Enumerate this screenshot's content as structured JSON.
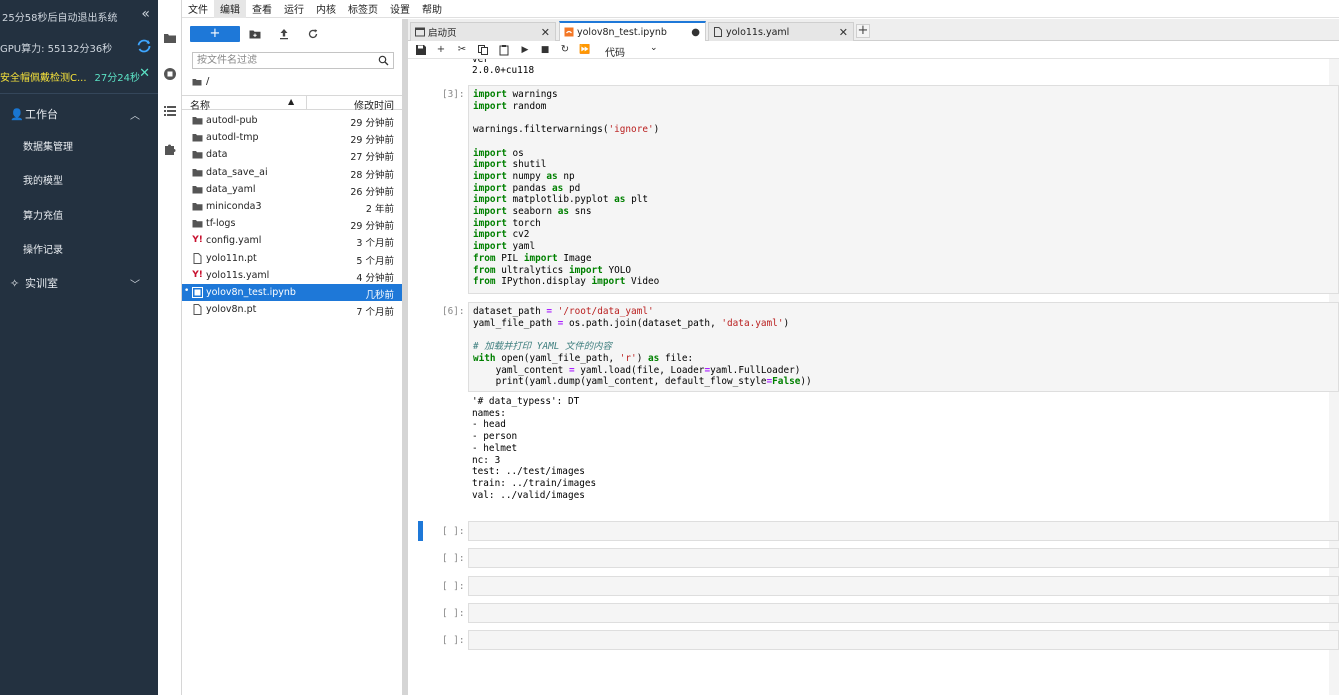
{
  "left_panel": {
    "title": "25分58秒后自动退出系统",
    "gpu": "GPU算力: 55132分36秒",
    "safe_name": "安全帽佩戴检测C...",
    "safe_time": "27分24秒",
    "menu": [
      {
        "label": "工作台"
      },
      {
        "label": "数据集管理"
      },
      {
        "label": "我的模型"
      },
      {
        "label": "算力充值"
      },
      {
        "label": "操作记录"
      },
      {
        "label": "实训室"
      }
    ]
  },
  "menubar": [
    "文件",
    "编辑",
    "查看",
    "运行",
    "内核",
    "标签页",
    "设置",
    "帮助"
  ],
  "filebrowser": {
    "new_label": "+",
    "filter_placeholder": "按文件名过滤",
    "breadcrumb": "/",
    "col_name": "名称",
    "col_modified": "修改时间",
    "files": [
      {
        "name": "autodl-pub",
        "time": "29 分钟前",
        "type": "folder"
      },
      {
        "name": "autodl-tmp",
        "time": "29 分钟前",
        "type": "folder"
      },
      {
        "name": "data",
        "time": "27 分钟前",
        "type": "folder"
      },
      {
        "name": "data_save_ai",
        "time": "28 分钟前",
        "type": "folder"
      },
      {
        "name": "data_yaml",
        "time": "26 分钟前",
        "type": "folder"
      },
      {
        "name": "miniconda3",
        "time": "2 年前",
        "type": "folder"
      },
      {
        "name": "tf-logs",
        "time": "29 分钟前",
        "type": "folder"
      },
      {
        "name": "config.yaml",
        "time": "3 个月前",
        "type": "yaml"
      },
      {
        "name": "yolo11n.pt",
        "time": "5 个月前",
        "type": "file"
      },
      {
        "name": "yolo11s.yaml",
        "time": "4 分钟前",
        "type": "yaml"
      },
      {
        "name": "yolov8n_test.ipynb",
        "time": "几秒前",
        "type": "notebook"
      },
      {
        "name": "yolov8n.pt",
        "time": "7 个月前",
        "type": "file"
      }
    ]
  },
  "tabs": [
    {
      "label": "启动页"
    },
    {
      "label": "yolov8n_test.ipynb"
    },
    {
      "label": "yolo11s.yaml"
    }
  ],
  "nb_toolbar": {
    "cell_type": "代码"
  },
  "notebook": {
    "top_output": "2.0.0+cu118",
    "cell3_prompt": "[3]:",
    "cell6_prompt": "[6]:",
    "empty_prompt": "[ ]:",
    "cell6_output": "'# data_typess': DT\nnames:\n- head\n- person\n- helmet\nnc: 3\ntest: ../test/images\ntrain: ../train/images\nval: ../valid/images"
  },
  "colors": {
    "accent": "#1e78d8",
    "dark_panel": "#233140",
    "keyword": "#008000",
    "string": "#ba2121"
  }
}
